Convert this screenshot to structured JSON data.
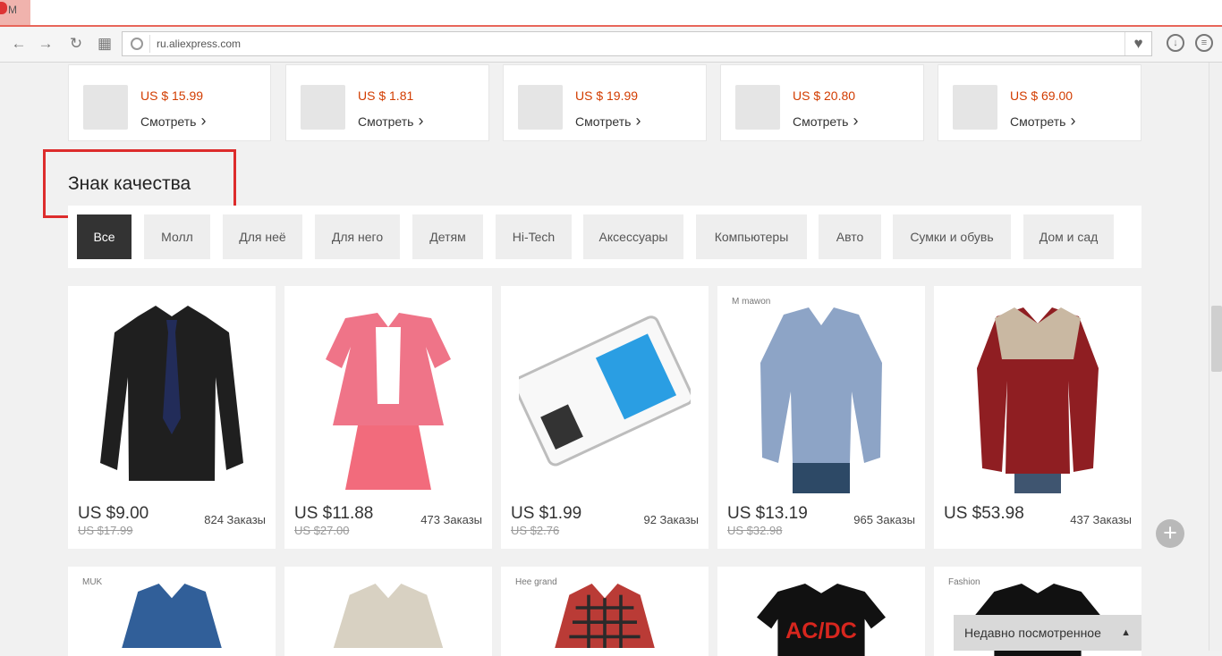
{
  "browser": {
    "tab_title": "M",
    "url": "ru.aliexpress.com",
    "icons": [
      "back-arrow-icon",
      "forward-arrow-icon",
      "reload-icon",
      "grid-icon",
      "heart-icon",
      "download-icon",
      "menu-icon"
    ]
  },
  "featured_items": [
    {
      "price": "US $ 15.99",
      "link": "Смотреть"
    },
    {
      "price": "US $ 1.81",
      "link": "Смотреть"
    },
    {
      "price": "US $ 19.99",
      "link": "Смотреть"
    },
    {
      "price": "US $ 20.80",
      "link": "Смотреть"
    },
    {
      "price": "US $ 69.00",
      "link": "Смотреть"
    }
  ],
  "section": {
    "title": "Знак качества",
    "categories": [
      "Все",
      "Молл",
      "Для неё",
      "Для него",
      "Детям",
      "Hi-Tech",
      "Аксессуары",
      "Компьютеры",
      "Авто",
      "Сумки и обувь",
      "Дом и сад"
    ]
  },
  "products": [
    {
      "price": "US $9.00",
      "old_price": "US $17.99",
      "orders": "824 Заказы"
    },
    {
      "price": "US $11.88",
      "old_price": "US $27.00",
      "orders": "473 Заказы"
    },
    {
      "price": "US $1.99",
      "old_price": "US $2.76",
      "orders": "92 Заказы"
    },
    {
      "price": "US $13.19",
      "old_price": "US $32.98",
      "orders": "965 Заказы",
      "brand": "M mawon"
    },
    {
      "price": "US $53.98",
      "old_price": "",
      "orders": "437 Заказы"
    }
  ],
  "bottom_products": [
    {
      "brand": "MUK"
    },
    {
      "brand": ""
    },
    {
      "brand": "Hee grand"
    },
    {
      "brand": "AC/DC"
    },
    {
      "brand": "Fashion"
    }
  ],
  "floating": {
    "recently_viewed": "Недавно посмотренное",
    "add_icon": "plus-icon"
  }
}
